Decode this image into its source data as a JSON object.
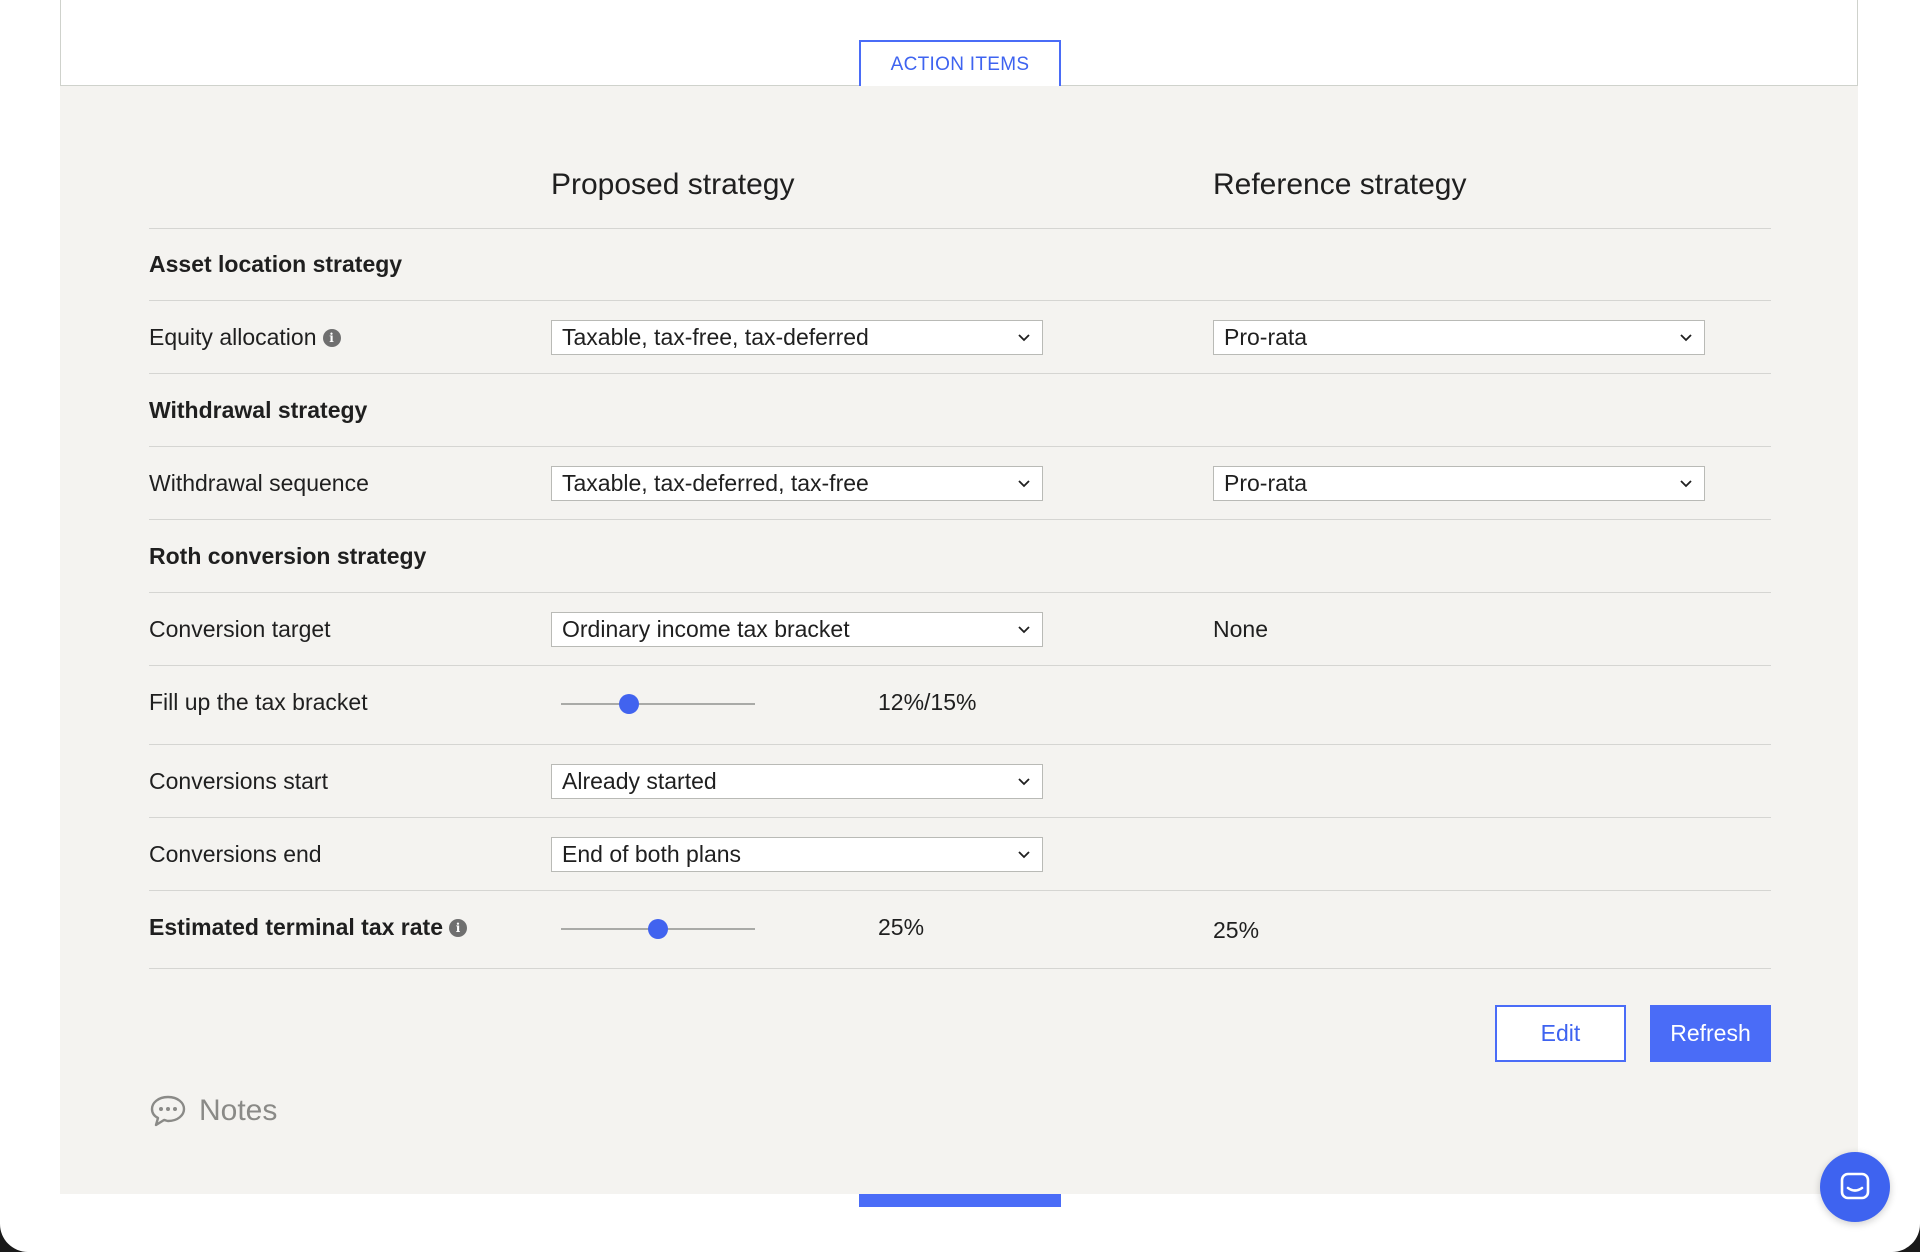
{
  "tab": {
    "action_items": "ACTION ITEMS"
  },
  "columns": {
    "proposed": "Proposed strategy",
    "reference": "Reference strategy"
  },
  "sections": {
    "asset_location": "Asset location strategy",
    "withdrawal": "Withdrawal strategy",
    "roth": "Roth conversion strategy"
  },
  "rows": {
    "equity_allocation": {
      "label": "Equity allocation",
      "proposed": "Taxable, tax-free, tax-deferred",
      "reference": "Pro-rata"
    },
    "withdrawal_sequence": {
      "label": "Withdrawal sequence",
      "proposed": "Taxable, tax-deferred, tax-free",
      "reference": "Pro-rata"
    },
    "conversion_target": {
      "label": "Conversion target",
      "proposed": "Ordinary income tax bracket",
      "reference": "None"
    },
    "fill_bracket": {
      "label": "Fill up the tax bracket",
      "value": "12%/15%",
      "slider_fraction": 0.35
    },
    "conversions_start": {
      "label": "Conversions start",
      "proposed": "Already started"
    },
    "conversions_end": {
      "label": "Conversions end",
      "proposed": "End of both plans"
    },
    "terminal_tax_rate": {
      "label": "Estimated terminal tax rate",
      "value": "25%",
      "reference": "25%",
      "slider_fraction": 0.5
    }
  },
  "buttons": {
    "edit": "Edit",
    "refresh": "Refresh"
  },
  "notes": {
    "label": "Notes"
  },
  "icons": {
    "info": "info-icon",
    "chevron": "chevron-down-icon",
    "notes": "speech-bubble-icon",
    "chat": "chat-icon"
  },
  "colors": {
    "accent": "#4a6cf7",
    "panel_bg": "#f4f3f0"
  }
}
